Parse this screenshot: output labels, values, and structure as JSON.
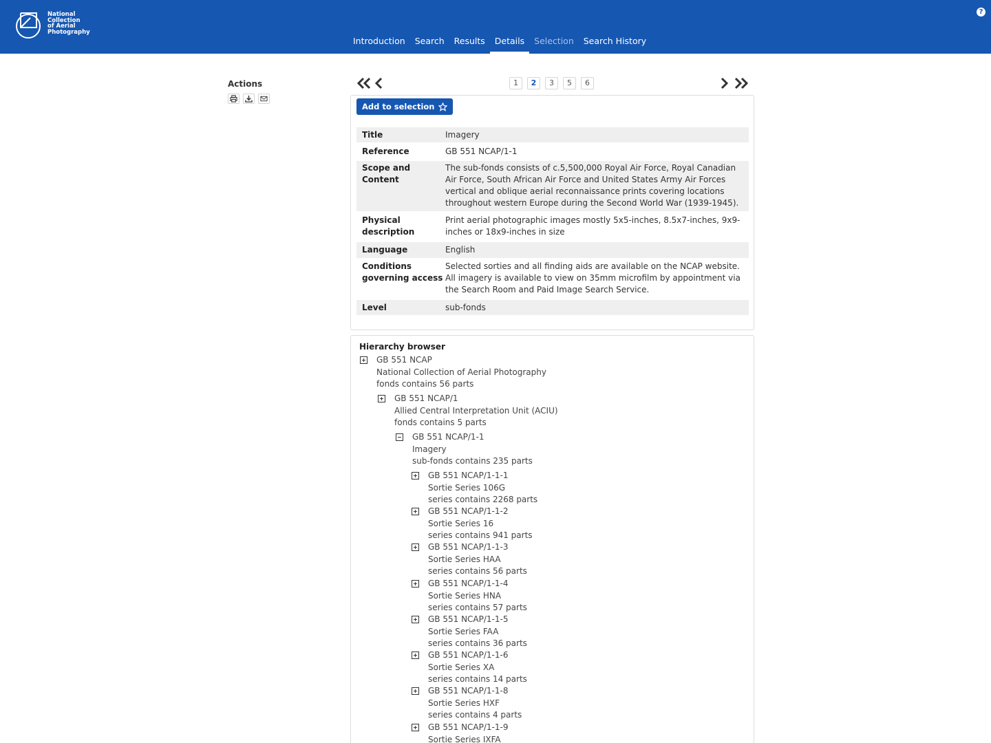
{
  "header": {
    "logo_lines": [
      "National",
      "Collection",
      "of Aerial",
      "Photography"
    ],
    "nav": [
      {
        "label": "Introduction"
      },
      {
        "label": "Search"
      },
      {
        "label": "Results"
      },
      {
        "label": "Details",
        "active": true
      },
      {
        "label": "Selection",
        "muted": true
      },
      {
        "label": "Search History"
      }
    ],
    "help_icon": "question-icon",
    "brand_color": "#1657b1"
  },
  "actions": {
    "title": "Actions",
    "icons": [
      "print-icon",
      "download-icon",
      "email-icon"
    ]
  },
  "pager": {
    "pages": [
      "1",
      "2",
      "3",
      "5",
      "6"
    ],
    "current": "2",
    "icons": [
      "first-page-icon",
      "previous-page-icon",
      "next-page-icon",
      "last-page-icon"
    ]
  },
  "details": {
    "add_button": "Add to selection",
    "rows": [
      {
        "label": "Title",
        "value": "Imagery"
      },
      {
        "label": "Reference",
        "value": "GB 551 NCAP/1-1"
      },
      {
        "label": "Scope and Content",
        "value": "The sub-fonds consists of c.5,500,000 Royal Air Force, Royal Canadian Air Force, South African Air Force and United States Army Air Forces vertical and oblique aerial reconnaissance prints covering locations throughout western Europe during the Second World War (1939-1945)."
      },
      {
        "label": "Physical description",
        "value": "Print aerial photographic images mostly 5x5-inches, 8.5x7-inches, 9x9-inches or 18x9-inches in size"
      },
      {
        "label": "Language",
        "value": "English"
      },
      {
        "label": "Conditions governing access",
        "value": "Selected sorties and all finding aids are available on the NCAP website. All imagery is available to view on 35mm microfilm by appointment via the Search Room and Paid Image Search Service."
      },
      {
        "label": "Level",
        "value": "sub-fonds"
      }
    ]
  },
  "hierarchy": {
    "title": "Hierarchy browser",
    "nodes": [
      {
        "ref": "GB 551 NCAP",
        "title": "National Collection of Aerial Photography",
        "info": "fonds contains 56 parts",
        "expanded": false
      },
      {
        "ref": "GB 551 NCAP/1",
        "title": "Allied Central Interpretation Unit (ACIU)",
        "info": "fonds contains 5 parts",
        "expanded": false
      },
      {
        "ref": "GB 551 NCAP/1-1",
        "title": "Imagery",
        "info": "sub-fonds contains 235 parts",
        "expanded": true
      },
      {
        "ref": "GB 551 NCAP/1-1-1",
        "title": "Sortie Series 106G",
        "info": "series contains 2268 parts",
        "expanded": false
      },
      {
        "ref": "GB 551 NCAP/1-1-2",
        "title": "Sortie Series 16",
        "info": "series contains 941 parts",
        "expanded": false
      },
      {
        "ref": "GB 551 NCAP/1-1-3",
        "title": "Sortie Series HAA",
        "info": "series contains 56 parts",
        "expanded": false
      },
      {
        "ref": "GB 551 NCAP/1-1-4",
        "title": "Sortie Series HNA",
        "info": "series contains 57 parts",
        "expanded": false
      },
      {
        "ref": "GB 551 NCAP/1-1-5",
        "title": "Sortie Series FAA",
        "info": "series contains 36 parts",
        "expanded": false
      },
      {
        "ref": "GB 551 NCAP/1-1-6",
        "title": "Sortie Series XA",
        "info": "series contains 14 parts",
        "expanded": false
      },
      {
        "ref": "GB 551 NCAP/1-1-8",
        "title": "Sortie Series HXF",
        "info": "series contains 4 parts",
        "expanded": false
      },
      {
        "ref": "GB 551 NCAP/1-1-9",
        "title": "Sortie Series IXFA",
        "info": "",
        "expanded": false
      }
    ]
  }
}
